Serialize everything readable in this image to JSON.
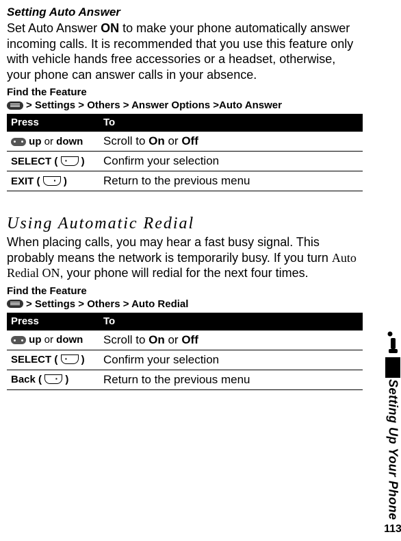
{
  "section1": {
    "heading": "Setting Auto Answer",
    "para": {
      "prefix": "Set Auto Answer ",
      "on": "ON",
      "suffix": " to make your phone automatically answer incoming calls. It is recommended that you use this feature only with vehicle hands free accessories or a headset, otherwise, your phone can answer calls in your absence."
    },
    "feature_label": "Find the Feature",
    "path": " > Settings > Others > Answer Options >Auto Answer",
    "table": {
      "head_press": "Press",
      "head_to": "To",
      "rows": [
        {
          "press_raw": "updown",
          "press_prefix": " up ",
          "press_mid": "or",
          "press_suffix": " down",
          "to_prefix": "Scroll to ",
          "to_b1": "On",
          "to_mid": " or ",
          "to_b2": "Off"
        },
        {
          "press_raw": "SELECT ( ",
          "press_after": " )",
          "to": "Confirm your selection"
        },
        {
          "press_raw": "EXIT ( ",
          "press_after": " )",
          "to": "Return to the previous menu"
        }
      ]
    }
  },
  "section2": {
    "heading": "Using Automatic Redial",
    "para": {
      "prefix": "When placing calls, you may hear a fast busy signal. This probably means the network is temporarily busy. If you turn ",
      "serif": "Auto Redial ON",
      "suffix": ", your phone will redial for the next four times."
    },
    "feature_label": "Find the Feature",
    "path": " > Settings > Others > Auto Redial",
    "table": {
      "head_press": "Press",
      "head_to": "To",
      "rows": [
        {
          "press_raw": "updown",
          "press_prefix": " up ",
          "press_mid": "or",
          "press_suffix": " down",
          "to_prefix": "Scroll to ",
          "to_b1": "On",
          "to_mid": " or ",
          "to_b2": "Off"
        },
        {
          "press_raw": "SELECT ( ",
          "press_after": " )",
          "to": "Confirm your selection"
        },
        {
          "press_raw": "Back ( ",
          "press_after": " )",
          "to": "Return to the previous menu"
        }
      ]
    }
  },
  "sidebar": {
    "title": "Setting Up Your Phone",
    "page": "113"
  }
}
